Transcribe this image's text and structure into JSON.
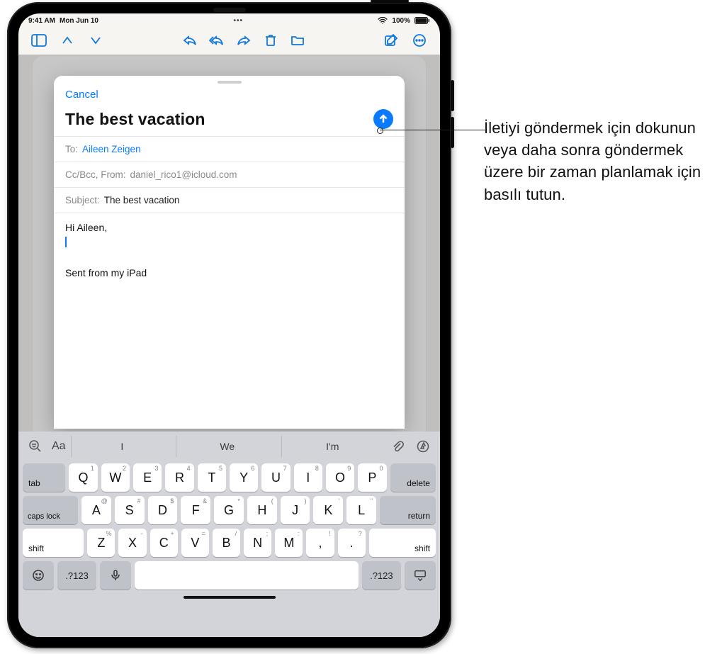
{
  "status": {
    "time": "9:41 AM",
    "date": "Mon Jun 10",
    "battery": "100%"
  },
  "compose": {
    "cancel": "Cancel",
    "title": "The best vacation",
    "to_label": "To:",
    "to_value": "Aileen Zeigen",
    "ccbcc_label": "Cc/Bcc, From:",
    "from_value": "daniel_rico1@icloud.com",
    "subject_label": "Subject:",
    "subject_value": "The best vacation",
    "body_greeting": "Hi Aileen,",
    "signature": "Sent from my iPad"
  },
  "suggestions": {
    "aa": "Aa",
    "w1": "I",
    "w2": "We",
    "w3": "I'm"
  },
  "keys": {
    "tab": "tab",
    "delete": "delete",
    "caps": "caps lock",
    "return": "return",
    "shift": "shift",
    "numsym": ".?123",
    "r1": [
      {
        "k": "Q",
        "s": "1"
      },
      {
        "k": "W",
        "s": "2"
      },
      {
        "k": "E",
        "s": "3"
      },
      {
        "k": "R",
        "s": "4"
      },
      {
        "k": "T",
        "s": "5"
      },
      {
        "k": "Y",
        "s": "6"
      },
      {
        "k": "U",
        "s": "7"
      },
      {
        "k": "I",
        "s": "8"
      },
      {
        "k": "O",
        "s": "9"
      },
      {
        "k": "P",
        "s": "0"
      }
    ],
    "r2": [
      {
        "k": "A",
        "s": "@"
      },
      {
        "k": "S",
        "s": "#"
      },
      {
        "k": "D",
        "s": "$"
      },
      {
        "k": "F",
        "s": "&"
      },
      {
        "k": "G",
        "s": "*"
      },
      {
        "k": "H",
        "s": "("
      },
      {
        "k": "J",
        "s": ")"
      },
      {
        "k": "K",
        "s": "'"
      },
      {
        "k": "L",
        "s": "\""
      }
    ],
    "r3": [
      {
        "k": "Z",
        "s": "%"
      },
      {
        "k": "X",
        "s": "-"
      },
      {
        "k": "C",
        "s": "+"
      },
      {
        "k": "V",
        "s": "="
      },
      {
        "k": "B",
        "s": "/"
      },
      {
        "k": "N",
        "s": ";"
      },
      {
        "k": "M",
        "s": ":"
      },
      {
        "k": ",",
        "s": "!"
      },
      {
        "k": ".",
        "s": "?"
      }
    ]
  },
  "callout": "İletiyi göndermek için dokunun veya daha sonra göndermek üzere bir zaman planlamak için basılı tutun."
}
